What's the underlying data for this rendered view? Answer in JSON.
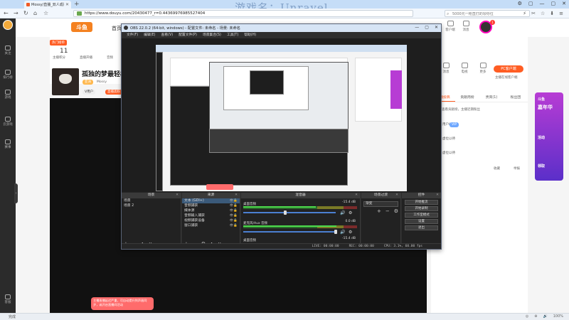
{
  "browser": {
    "watermark": "游戏名：Unravel",
    "tab_title": "Mossy/直播_双人成行",
    "new_tab": "+",
    "url": "https://www.douyu.com/20430477_r=0.44369976985527404",
    "search_placeholder": "5000元一枪直打的领导位",
    "window_controls": [
      "⚙",
      "▢",
      "—",
      "▢",
      "✕"
    ],
    "right_tools": [
      "⚡",
      "✂",
      "☆",
      "⬇",
      "≡"
    ]
  },
  "douyu": {
    "logo": "斗鱼",
    "nav_home": "首页",
    "left_nav": [
      {
        "label": "关注",
        "icon": "heart-icon"
      },
      {
        "label": "排行榜",
        "icon": "rank-icon"
      },
      {
        "label": "游戏",
        "icon": "game-icon"
      },
      {
        "label": "云游戏",
        "icon": "cloud-icon"
      },
      {
        "label": "赛事",
        "icon": "trophy-icon"
      },
      {
        "label": "客服",
        "icon": "service-icon"
      }
    ],
    "top_icons": [
      {
        "label": "客户端",
        "icon": "client-icon"
      },
      {
        "label": "消息",
        "icon": "bell-icon"
      }
    ],
    "user_badge": "1",
    "room": {
      "hot_label": "热门榜单",
      "hot_value": "11",
      "hot_caption": "主播积分",
      "stat1_label": "直播开播",
      "stat2_label": "音频",
      "title": "孤独的梦最轻松",
      "anchor_name": "Mossy",
      "tag1": "亚洲",
      "tag2": "V用户",
      "tag3": "直播高粉"
    },
    "right": {
      "icons": [
        "消息",
        "电视",
        "更多"
      ],
      "pc_button": "PC客户端",
      "pc_caption": "主播在线客户端",
      "tabs": [
        "主播投稿",
        "贡献周榜",
        "贵宾(1)",
        "粉丝团"
      ],
      "rank_note": "点击查看贡献榜，主播近期粉丝",
      "rank_rows": [
        "用户ID",
        "虚位以待",
        "虚位以待"
      ],
      "vip_badge": "VIP",
      "actions": [
        "收藏",
        "举报"
      ]
    },
    "promo": {
      "line1": "斗鱼",
      "line2": "嘉年华",
      "line3": "活动",
      "line4": "领取"
    },
    "toast": "主播直播延迟严重，可自动提升到声画同步，或开启直播间活动",
    "status_left": "完成",
    "status_right": [
      "◎",
      "⊕",
      "🔊",
      "100%"
    ]
  },
  "obs": {
    "title": "OBS 22.0.2 (64-bit, windows) - 配置文件: 未命名 - 场景: 未命名",
    "window_controls": [
      "—",
      "▢",
      "✕"
    ],
    "menu": [
      "文件(F)",
      "编辑(E)",
      "查看(V)",
      "配置文件(P)",
      "场景集合(S)",
      "工具(T)",
      "帮助(H)"
    ],
    "docks": {
      "scenes": {
        "title": "场景",
        "items": [
          "场景",
          "场景 2"
        ],
        "close": "✕"
      },
      "sources": {
        "title": "来源",
        "close": "✕",
        "items": [
          "文本 (GDI+)",
          "音频捕获",
          "媒体源",
          "音频输入捕获",
          "视频捕获设备",
          "窗口捕获"
        ],
        "icon_eye": "👁",
        "icon_lock": "🔒"
      },
      "mixer": {
        "title": "混音器",
        "close": "✕",
        "channels": [
          {
            "name": "桌面音频",
            "db": "-15.4 dB",
            "level": 0.64,
            "fader": 0.45
          },
          {
            "name": "麦克风/Aux 音频",
            "db": "0.0 dB",
            "level": 0.82,
            "fader": 1.0
          },
          {
            "name": "桌面音频",
            "db": "-15.4 dB",
            "level": 0.0,
            "fader": 0.0
          }
        ]
      },
      "transitions": {
        "title": "场景过渡",
        "close": "✕",
        "selected": "渐变",
        "icons": [
          "+",
          "−",
          "⚙"
        ]
      },
      "controls": {
        "title": "控件",
        "close": "✕",
        "buttons": [
          "开始推流",
          "开始录制",
          "工作室模式",
          "设置",
          "退出"
        ]
      }
    },
    "dock_footer_icons": [
      "+",
      "−",
      "∧",
      "∨"
    ],
    "status": [
      "LIVE: 00:00:00",
      "REC: 00:00:00",
      "CPU: 3.1%, 60.00 fps"
    ]
  }
}
